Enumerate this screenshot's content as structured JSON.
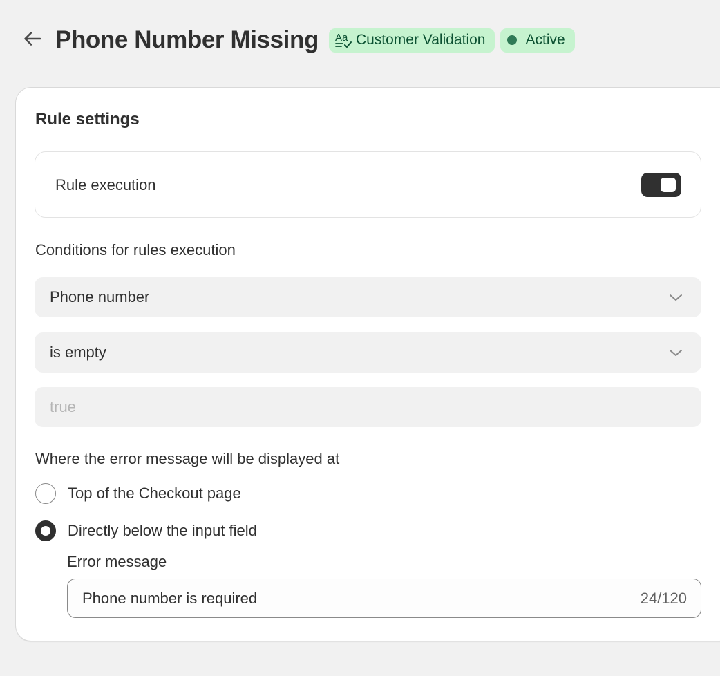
{
  "header": {
    "title": "Phone Number Missing",
    "category_badge": "Customer Validation",
    "status_badge": "Active"
  },
  "card": {
    "title": "Rule settings",
    "rule_execution": {
      "label": "Rule execution",
      "enabled": true
    },
    "conditions": {
      "label": "Conditions for rules execution",
      "field_select": "Phone number",
      "operator_select": "is empty",
      "value_placeholder": "true"
    },
    "display": {
      "label": "Where the error message will be displayed at",
      "options": [
        {
          "label": "Top of the Checkout page",
          "selected": false
        },
        {
          "label": "Directly below the input field",
          "selected": true
        }
      ]
    },
    "error_message": {
      "label": "Error message",
      "value": "Phone number is required",
      "counter": "24/120"
    }
  },
  "colors": {
    "background": "#f1f1f1",
    "badge_bg": "#c6f3cf",
    "badge_text": "#0c5132",
    "status_dot": "#2f7a56",
    "toggle_on": "#303030"
  },
  "icons": {
    "back": "arrow-left-icon",
    "category": "text-check-icon",
    "status": "status-dot-icon",
    "select": "chevron-down-icon"
  }
}
